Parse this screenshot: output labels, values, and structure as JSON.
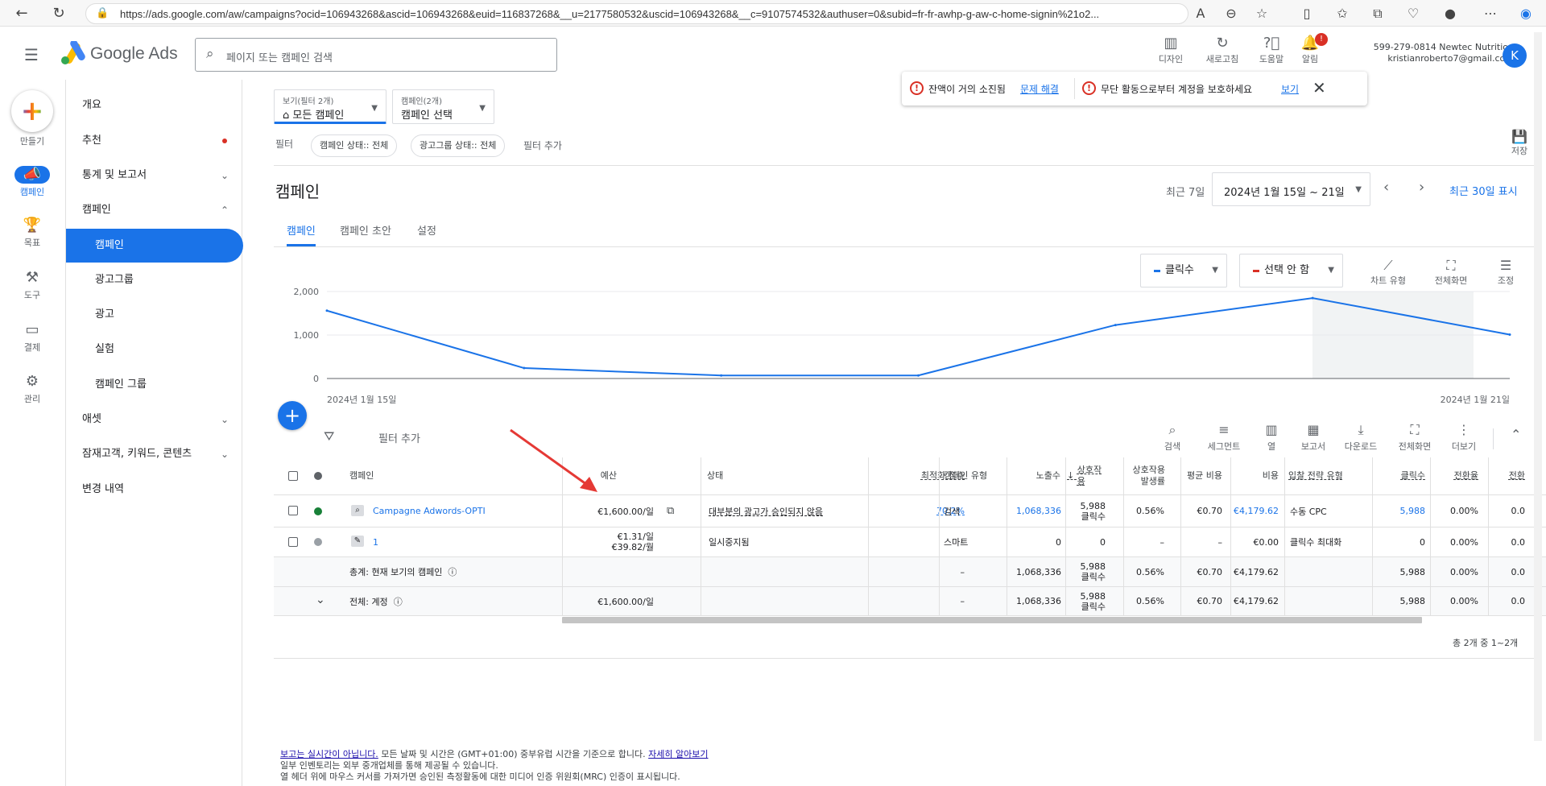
{
  "browser": {
    "url": "https://ads.google.com/aw/campaigns?ocid=106943268&ascid=106943268&euid=116837268&__u=2177580532&uscid=106943268&__c=9107574532&authuser=0&subid=fr-fr-awhp-g-aw-c-home-signin%21o2..."
  },
  "header": {
    "app_name": "Google Ads",
    "search_placeholder": "페이지 또는 캠페인 검색",
    "tools": [
      {
        "label": "디자인"
      },
      {
        "label": "새로고침"
      },
      {
        "label": "도움말"
      },
      {
        "label": "알림",
        "badge": "!"
      }
    ],
    "account_id_name": "599-279-0814 Newtec Nutrition",
    "account_email": "kristianroberto7@gmail.com",
    "avatar_letter": "K"
  },
  "rail": {
    "items": [
      {
        "label": "만들기"
      },
      {
        "label": "캠페인"
      },
      {
        "label": "목표"
      },
      {
        "label": "도구"
      },
      {
        "label": "결제"
      },
      {
        "label": "관리"
      }
    ]
  },
  "sidebar": {
    "items": [
      {
        "label": "개요"
      },
      {
        "label": "추천"
      },
      {
        "label": "통계 및 보고서"
      },
      {
        "label": "캠페인"
      },
      {
        "label": "캠페인"
      },
      {
        "label": "광고그룹"
      },
      {
        "label": "광고"
      },
      {
        "label": "실험"
      },
      {
        "label": "캠페인 그룹"
      },
      {
        "label": "애셋"
      },
      {
        "label": "잠재고객, 키워드, 콘텐츠"
      },
      {
        "label": "변경 내역"
      }
    ]
  },
  "view_selector": {
    "small": "보기(필터 2개)",
    "value": "모든 캠페인"
  },
  "campaign_selector": {
    "small": "캠페인(2개)",
    "value": "캠페인 선택"
  },
  "filters": {
    "label": "필터",
    "chips": [
      "캠페인 상태:: 전체",
      "광고그룹 상태:: 전체"
    ],
    "add": "필터 추가",
    "save": "저장"
  },
  "alerts": {
    "balance": "잔액이 거의 소진됨",
    "balance_link": "문제 해결",
    "protect": "무단 활동으로부터 계정을 보호하세요",
    "protect_link": "보기"
  },
  "page": {
    "title": "캠페인",
    "date_preset": "최근 7일",
    "date_range": "2024년 1월 15일 ~ 21일",
    "show_30": "최근 30일 표시",
    "tabs": [
      "캠페인",
      "캠페인 초안",
      "설정"
    ]
  },
  "chart_controls": {
    "metric1": "클릭수",
    "metric2": "선택 안 함",
    "tools": [
      "차트 유형",
      "전체화면",
      "조정"
    ],
    "metric1_color": "#1a73e8",
    "metric2_color": "#d93025"
  },
  "chart_data": {
    "type": "line",
    "x": [
      "2024-01-15",
      "2024-01-16",
      "2024-01-17",
      "2024-01-18",
      "2024-01-19",
      "2024-01-20",
      "2024-01-21"
    ],
    "x_start_label": "2024년 1월 15일",
    "x_end_label": "2024년 1월 21일",
    "series": [
      {
        "values": [
          1560,
          240,
          70,
          70,
          1230,
          1850,
          1010
        ]
      }
    ],
    "ylim": [
      0,
      2000
    ],
    "yticks": [
      {
        "v": 0,
        "label": "0"
      },
      {
        "v": 1000,
        "label": "1,000"
      },
      {
        "v": 2000,
        "label": "2,000"
      }
    ],
    "grid": true
  },
  "table_toolbar": {
    "add_filter": "필터 추가",
    "tools": [
      "검색",
      "세그먼트",
      "열",
      "보고서",
      "다운로드",
      "전체화면",
      "더보기"
    ]
  },
  "table": {
    "headers": {
      "campaign": "캠페인",
      "budget": "예산",
      "status": "상태",
      "opt_score": "최적화 점수",
      "type": "캠페인 유형",
      "impr": "노출수",
      "interactions": "상호작용",
      "int_rate": "상호작용 발생률",
      "avg_cost": "평균 비용",
      "cost": "비용",
      "bid": "입찰 전략 유형",
      "clicks": "클릭수",
      "conv_rate": "전환율",
      "conv": "전환"
    },
    "rows": [
      {
        "name": "Campagne  Adwords-OPTI",
        "budget": "€1,600.00/일",
        "budget2": "",
        "status": "대부분의 광고가 승인되지 않음",
        "opt": "70.2%",
        "type": "검색",
        "impr": "1,068,336",
        "inter": "5,988",
        "inter_unit": "클릭수",
        "rate": "0.56%",
        "avg": "€0.70",
        "cost": "€4,179.62",
        "bid": "수동 CPC",
        "clicks": "5,988",
        "conv_rate": "0.00%",
        "conv": "0.0"
      },
      {
        "name": "1",
        "budget": "€1.31/일",
        "budget2": "€39.82/월",
        "status": "일시중지됨",
        "opt": "–",
        "type": "스마트",
        "impr": "0",
        "inter": "0",
        "inter_unit": "",
        "rate": "–",
        "avg": "–",
        "cost": "€0.00",
        "bid": "클릭수 최대화",
        "clicks": "0",
        "conv_rate": "0.00%",
        "conv": "0.0"
      }
    ],
    "total_view": {
      "label": "총계: 현재 보기의 캠페인",
      "budget": "",
      "opt": "–",
      "impr": "1,068,336",
      "inter": "5,988",
      "inter_unit": "클릭수",
      "rate": "0.56%",
      "avg": "€0.70",
      "cost": "€4,179.62",
      "clicks": "5,988",
      "conv_rate": "0.00%",
      "conv": "0.0"
    },
    "total_account": {
      "label": "전체: 계정",
      "budget": "€1,600.00/일",
      "opt": "–",
      "impr": "1,068,336",
      "inter": "5,988",
      "inter_unit": "클릭수",
      "rate": "0.56%",
      "avg": "€0.70",
      "cost": "€4,179.62",
      "clicks": "5,988",
      "conv_rate": "0.00%",
      "conv": "0.0"
    },
    "pagination": "총 2개 중 1~2개"
  },
  "footer": {
    "line1_link": "보고는 실시간이 아닙니다.",
    "line1_text": " 모든 날짜 및 시간은 (GMT+01:00) 중부유럽 시간을 기준으로 합니다.",
    "line1_link2": "자세히 알아보기",
    "line2": "일부 인벤토리는 외부 중개업체를 통해 제공될 수 있습니다.",
    "line3": "열 헤더 위에 마우스 커서를 가져가면 승인된 측정활동에 대한 미디어 인증 위원회(MRC) 인증이 표시됩니다."
  }
}
